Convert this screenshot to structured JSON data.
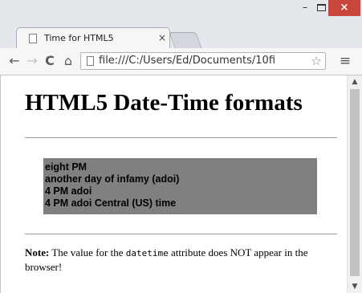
{
  "window": {
    "minimize": "–",
    "close": "×"
  },
  "tab": {
    "title": "Time for HTML5",
    "close": "×"
  },
  "toolbar": {
    "back": "←",
    "forward": "→",
    "reload": "C",
    "home": "⌂",
    "url": "file:///C:/Users/Ed/Documents/10fi",
    "bookmark_star": "☆",
    "menu": "≡"
  },
  "page": {
    "heading": "HTML5 Date-Time formats",
    "times": [
      "eight PM",
      "another day of infamy (adoi)",
      "4 PM adoi",
      "4 PM adoi Central (US) time"
    ],
    "note_label": "Note:",
    "note_pre": " The value for the ",
    "note_code": "datetime",
    "note_post": " attribute does NOT appear in the browser!"
  },
  "scrollbar": {
    "up": "▲",
    "down": "▼"
  }
}
